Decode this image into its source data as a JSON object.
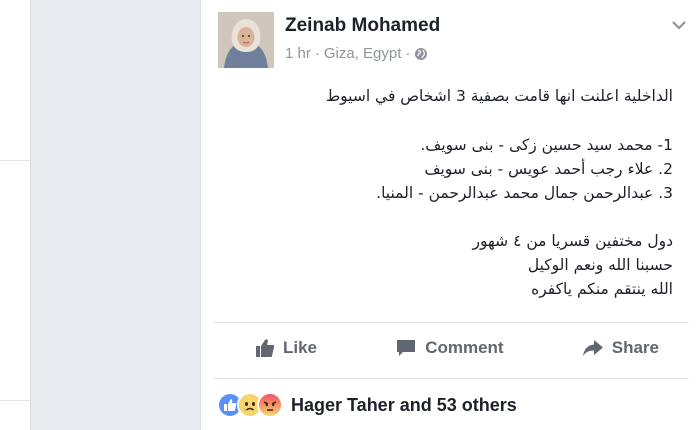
{
  "post": {
    "author": "Zeinab Mohamed",
    "time": "1 hr",
    "location": "Giza, Egypt",
    "separator": "·",
    "lines": [
      "الداخلية اعلنت انها قامت بصفية 3 اشخاص في اسيوط",
      "1- محمد سيد حسين زكى -  بنى سويف.",
      "2. علاء رجب أحمد عويس - بنى سويف",
      "3. عبدالرحمن جمال محمد عبدالرحمن -  المنيا.",
      "دول مختفين قسريا من ٤ شهور",
      "حسبنا الله ونعم الوكيل",
      "الله ينتقم منكم ياكفره"
    ]
  },
  "actions": {
    "like": "Like",
    "comment": "Comment",
    "share": "Share"
  },
  "reactions": {
    "summary": "Hager Taher and 53 others",
    "icons": [
      "like-reaction-icon",
      "sad-reaction-icon",
      "angry-reaction-icon"
    ]
  },
  "colors": {
    "background": "#e9ebee",
    "text": "#1d2129",
    "secondary": "#90949c",
    "action": "#616770",
    "like_blue": "#5890ff",
    "angry_red": "#f25268",
    "sad_yellow": "#f7d56b"
  }
}
